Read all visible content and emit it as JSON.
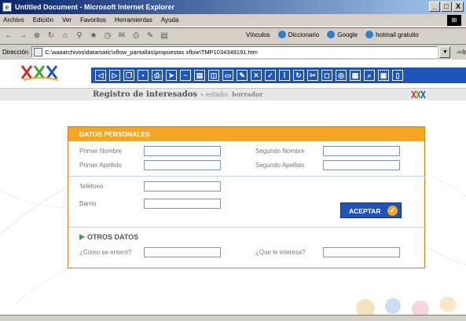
{
  "window": {
    "title": "Untitled Document - Microsoft Internet Explorer",
    "buttons": [
      "_",
      "□",
      "X"
    ]
  },
  "menu": [
    "Archivo",
    "Edición",
    "Ver",
    "Favoritos",
    "Herramientas",
    "Ayuda"
  ],
  "links_bar": {
    "label": "Vínculos",
    "links": [
      "Diccionario",
      "Google",
      "hotmail gratuito"
    ]
  },
  "address": {
    "label": "Dirección",
    "url": "C:\\aaaarchivos\\datamatic\\xflow_pantallas\\propuestas xflow\\TMP1034349191.htm",
    "go": "Ir"
  },
  "app": {
    "title": "Registro de interesados",
    "state_label": "» estado:",
    "state_value": "borrador",
    "brand_colors": {
      "blue": "#2054b8",
      "orange": "#f5a623",
      "green": "#3fa23a",
      "red": "#d72a2a"
    }
  },
  "form": {
    "section_title": "DATOS PERSONALES",
    "fields": {
      "primer_nombre": "Primer Nombre",
      "segundo_nombre": "Segundo Nombre",
      "primer_apellido": "Primer Apellido",
      "segundo_apellido": "Segundo Apellido",
      "telefono": "Teléfono",
      "barrio": "Barrio"
    },
    "accept_button": "ACEPTAR",
    "other_section": "OTROS DATOS",
    "como_se_entero": "¿Cómo se enteró?",
    "que_le_interesa": "¿Que le interesa?"
  }
}
